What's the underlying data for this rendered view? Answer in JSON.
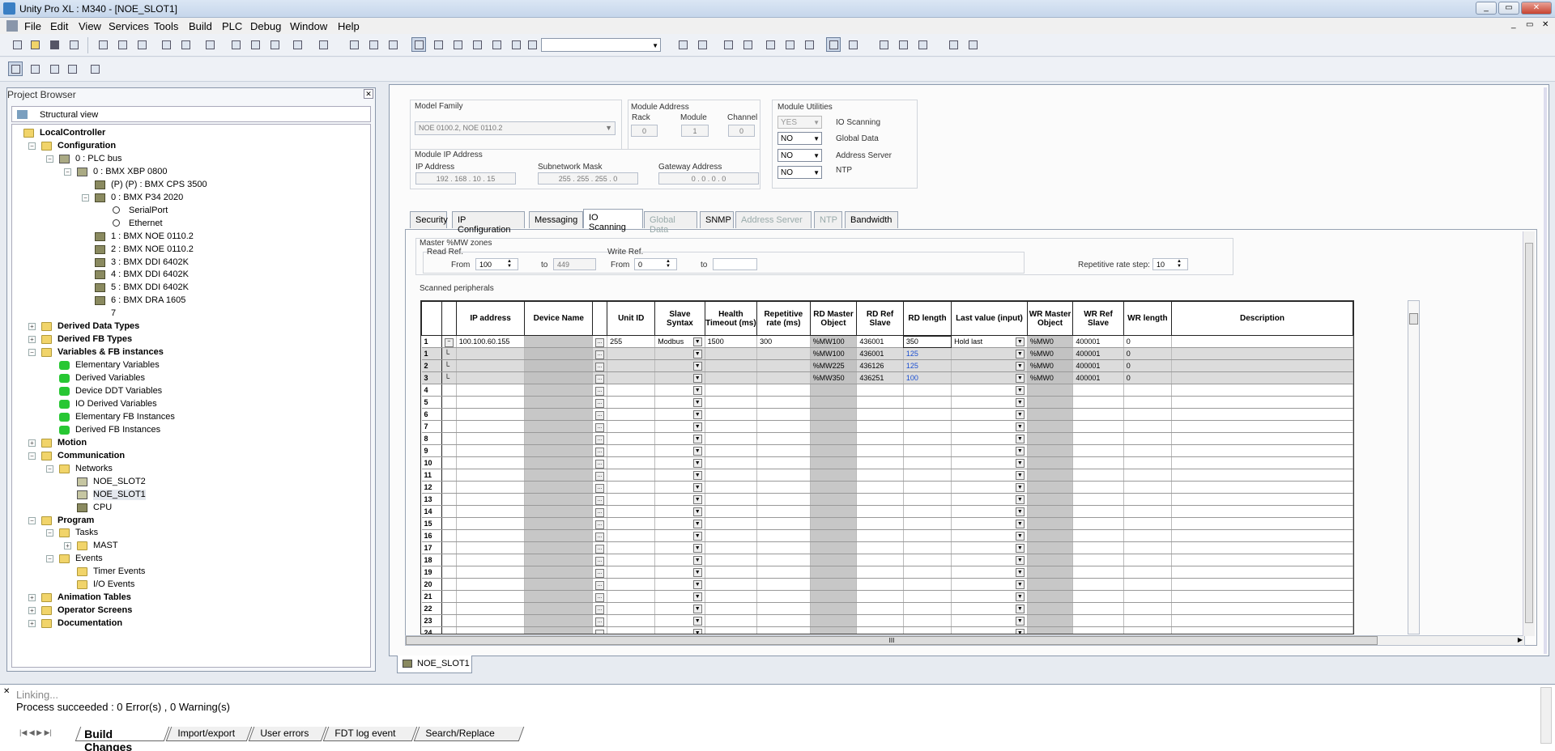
{
  "window": {
    "title": "Unity Pro XL : M340 - [NOE_SLOT1]",
    "min": "_",
    "max": "▭",
    "close": "✕"
  },
  "menu": [
    "File",
    "Edit",
    "View",
    "Services",
    "Tools",
    "Build",
    "PLC",
    "Debug",
    "Window",
    "Help"
  ],
  "project_browser": {
    "title": "Project Browser",
    "view": "Structural view",
    "tree": [
      {
        "label": "LocalController",
        "bold": true
      },
      {
        "label": "Configuration",
        "bold": true
      },
      {
        "label": "0 : PLC bus"
      },
      {
        "label": "0 : BMX XBP 0800"
      },
      {
        "label": "(P) (P) : BMX CPS 3500"
      },
      {
        "label": "0 : BMX P34 2020"
      },
      {
        "label": "SerialPort"
      },
      {
        "label": "Ethernet"
      },
      {
        "label": "1 : BMX NOE 0110.2"
      },
      {
        "label": "2 : BMX NOE 0110.2"
      },
      {
        "label": "3 : BMX DDI 6402K"
      },
      {
        "label": "4 : BMX DDI 6402K"
      },
      {
        "label": "5 : BMX DDI 6402K"
      },
      {
        "label": "6 : BMX DRA 1605"
      },
      {
        "label": "7"
      },
      {
        "label": "Derived Data Types",
        "bold": true
      },
      {
        "label": "Derived FB Types",
        "bold": true
      },
      {
        "label": "Variables & FB instances",
        "bold": true
      },
      {
        "label": "Elementary Variables"
      },
      {
        "label": "Derived Variables"
      },
      {
        "label": "Device DDT Variables"
      },
      {
        "label": "IO Derived Variables"
      },
      {
        "label": "Elementary FB Instances"
      },
      {
        "label": "Derived FB Instances"
      },
      {
        "label": "Motion",
        "bold": true
      },
      {
        "label": "Communication",
        "bold": true
      },
      {
        "label": "Networks"
      },
      {
        "label": "NOE_SLOT2"
      },
      {
        "label": "NOE_SLOT1"
      },
      {
        "label": "CPU"
      },
      {
        "label": "Program",
        "bold": true
      },
      {
        "label": "Tasks"
      },
      {
        "label": "MAST"
      },
      {
        "label": "Events"
      },
      {
        "label": "Timer Events"
      },
      {
        "label": "I/O Events"
      },
      {
        "label": "Animation Tables",
        "bold": true
      },
      {
        "label": "Operator Screens",
        "bold": true
      },
      {
        "label": "Documentation",
        "bold": true
      }
    ]
  },
  "module": {
    "model_family_label": "Model Family",
    "model_family_value": "NOE 0100.2, NOE 0110.2",
    "module_address_label": "Module Address",
    "rack_label": "Rack",
    "rack": "0",
    "module_label": "Module",
    "module": "1",
    "channel_label": "Channel",
    "channel": "0",
    "ip_group_label": "Module IP Address",
    "ip_label": "IP Address",
    "ip": "192 . 168 . 10 . 15",
    "subnet_label": "Subnetwork Mask",
    "subnet": "255 . 255 . 255 . 0",
    "gateway_label": "Gateway Address",
    "gateway": "0 . 0 . 0 . 0",
    "utilities_label": "Module Utilities",
    "util_io_value": "YES",
    "util_io": "IO Scanning",
    "util_gd_value": "NO",
    "util_gd": "Global Data",
    "util_as_value": "NO",
    "util_as": "Address Server",
    "util_ntp_value": "NO",
    "util_ntp": "NTP"
  },
  "tabs": [
    "Security",
    "IP Configuration",
    "Messaging",
    "IO Scanning",
    "Global Data",
    "SNMP",
    "Address Server",
    "NTP",
    "Bandwidth"
  ],
  "io": {
    "zones_label": "Master %MW zones",
    "read_ref": "Read Ref.",
    "from": "From",
    "to": "to",
    "read_from": "100",
    "read_to": "449",
    "write_ref": "Write Ref.",
    "write_from": "0",
    "write_to": "",
    "rate_step_label": "Repetitive rate step:",
    "rate_step": "10",
    "scanned_label": "Scanned peripherals"
  },
  "grid": {
    "headers": [
      "",
      "",
      "IP address",
      "Device Name",
      "",
      "Unit ID",
      "Slave Syntax",
      "Health Timeout (ms)",
      "Repetitive rate (ms)",
      "RD Master Object",
      "RD Ref Slave",
      "RD length",
      "Last value (input)",
      "WR Master Object",
      "WR Ref Slave",
      "WR length",
      "Description"
    ],
    "rows": [
      {
        "n": "1",
        "ip": "100.100.60.155",
        "unit": "255",
        "syntax": "Modbus",
        "health": "1500",
        "rate": "300",
        "rdm": "%MW100",
        "rdref": "436001",
        "rdlen": "350",
        "last": "Hold last",
        "wrm": "%MW0",
        "wrref": "400001",
        "wrlen": "0",
        "sub": false
      },
      {
        "n": "1",
        "ip": "",
        "unit": "",
        "syntax": "",
        "health": "",
        "rate": "",
        "rdm": "%MW100",
        "rdref": "436001",
        "rdlen": "125",
        "last": "",
        "wrm": "%MW0",
        "wrref": "400001",
        "wrlen": "0",
        "sub": true
      },
      {
        "n": "2",
        "ip": "",
        "unit": "",
        "syntax": "",
        "health": "",
        "rate": "",
        "rdm": "%MW225",
        "rdref": "436126",
        "rdlen": "125",
        "last": "",
        "wrm": "%MW0",
        "wrref": "400001",
        "wrlen": "0",
        "sub": true
      },
      {
        "n": "3",
        "ip": "",
        "unit": "",
        "syntax": "",
        "health": "",
        "rate": "",
        "rdm": "%MW350",
        "rdref": "436251",
        "rdlen": "100",
        "last": "",
        "wrm": "%MW0",
        "wrref": "400001",
        "wrlen": "0",
        "sub": true
      }
    ],
    "empty_rows": [
      "4",
      "5",
      "6",
      "7",
      "8",
      "9",
      "10",
      "11",
      "12",
      "13",
      "14",
      "15",
      "16",
      "17",
      "18",
      "19",
      "20",
      "21",
      "22",
      "23",
      "24"
    ],
    "hscroll_mark": "III"
  },
  "doc_tab": "NOE_SLOT1",
  "output": {
    "line1": "Linking...",
    "line2": "Process succeeded  : 0 Error(s) , 0 Warning(s)",
    "tabs": [
      "Build Changes",
      "Import/export",
      "User errors",
      "FDT log event",
      "Search/Replace"
    ]
  }
}
